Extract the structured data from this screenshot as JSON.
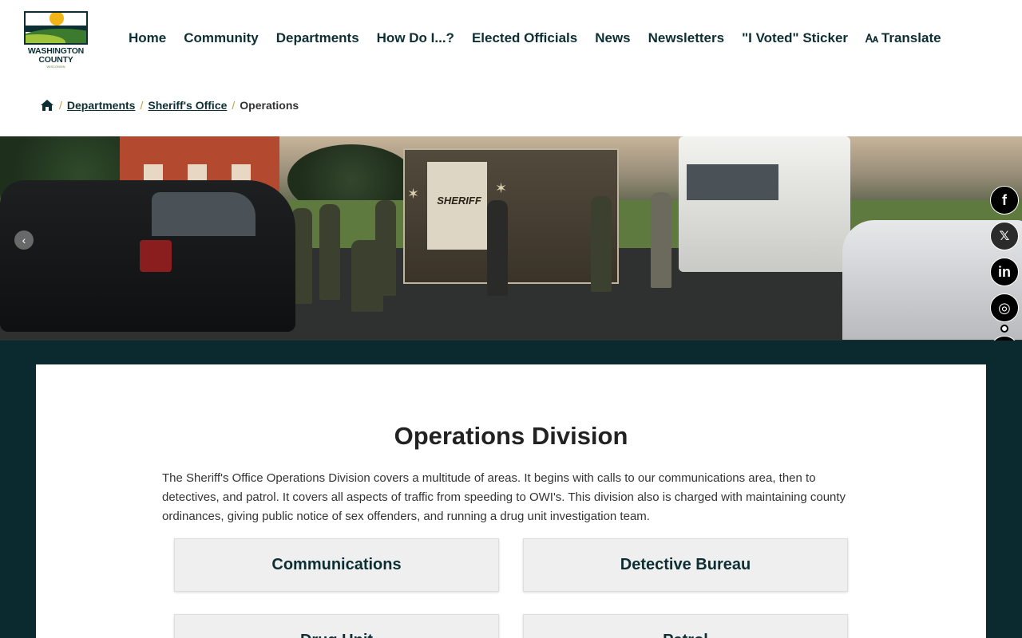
{
  "header": {
    "logo_text": "WASHINGTON COUNTY",
    "logo_sub": "WISCONSIN",
    "nav": [
      {
        "label": "Home"
      },
      {
        "label": "Community"
      },
      {
        "label": "Departments"
      },
      {
        "label": "How Do I...?"
      },
      {
        "label": "Elected Officials"
      },
      {
        "label": "News"
      },
      {
        "label": "Newsletters"
      },
      {
        "label": "\"I Voted\" Sticker"
      },
      {
        "label": "Translate",
        "icon": "translate-icon"
      }
    ]
  },
  "breadcrumb": {
    "home_icon": "home-icon",
    "items": [
      {
        "label": "Departments"
      },
      {
        "label": "Sheriff's Office"
      }
    ],
    "current": "Operations",
    "separator": "/"
  },
  "hero": {
    "truck_label": "SHERIFF",
    "prev_icon": "chevron-left-icon"
  },
  "social": {
    "items": [
      {
        "name": "facebook-icon",
        "glyph": "f"
      },
      {
        "name": "x-icon",
        "glyph": "𝕏"
      },
      {
        "name": "linkedin-icon",
        "glyph": "in"
      },
      {
        "name": "instagram-icon",
        "glyph": "◎"
      },
      {
        "name": "youtube-icon",
        "glyph": "▶"
      }
    ]
  },
  "main": {
    "title": "Operations Division",
    "intro": "The Sheriff's Office Operations Division covers a multitude of areas. It begins with calls to our communications area, then to detectives, and patrol. It covers all aspects of traffic from speeding to OWI's. This division also is charged with maintaining county ordinances, giving public notice of sex offenders, and running a drug unit investigation team.",
    "cards": [
      {
        "label": "Communications"
      },
      {
        "label": "Detective Bureau"
      },
      {
        "label": "Drug Unit"
      },
      {
        "label": "Patrol"
      }
    ]
  },
  "colors": {
    "brand_dark": "#0b2a2f",
    "accent_gold": "#c59a3c",
    "card_bg": "#efefef"
  }
}
